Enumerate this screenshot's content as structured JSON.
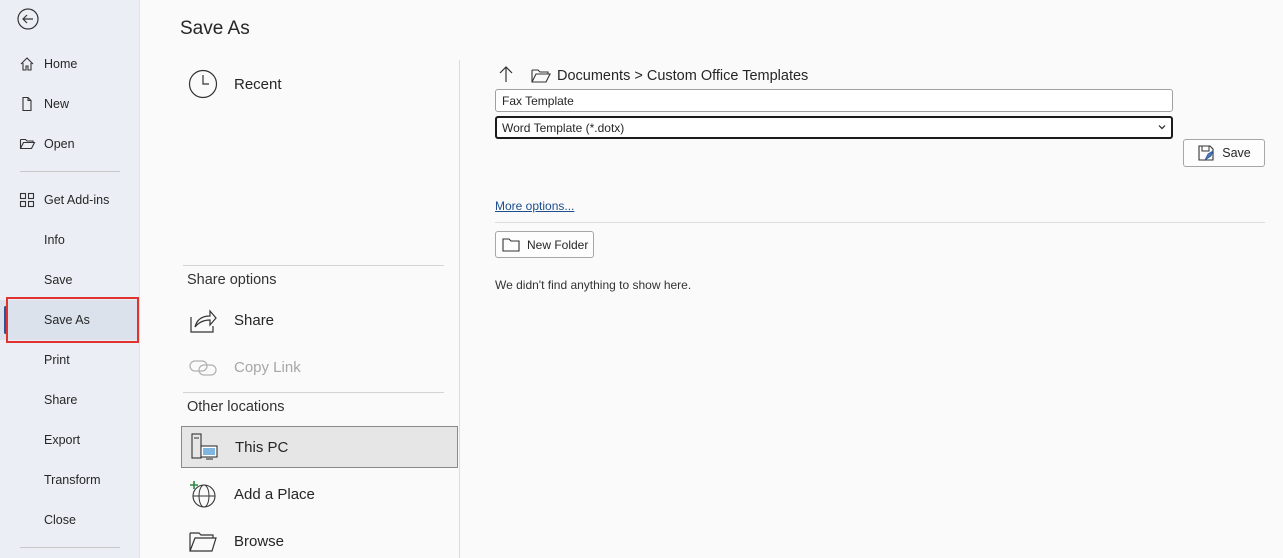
{
  "nav": {
    "items": [
      {
        "label": "Home"
      },
      {
        "label": "New"
      },
      {
        "label": "Open"
      },
      {
        "label": "Get Add-ins"
      },
      {
        "label": "Info"
      },
      {
        "label": "Save"
      },
      {
        "label": "Save As"
      },
      {
        "label": "Print"
      },
      {
        "label": "Share"
      },
      {
        "label": "Export"
      },
      {
        "label": "Transform"
      },
      {
        "label": "Close"
      }
    ],
    "selected": "Save As"
  },
  "main": {
    "title": "Save As",
    "recent_label": "Recent",
    "share_options_header": "Share options",
    "share_label": "Share",
    "copy_link_label": "Copy Link",
    "other_locations_header": "Other locations",
    "this_pc_label": "This PC",
    "add_place_label": "Add a Place",
    "browse_label": "Browse"
  },
  "save_panel": {
    "path": "Documents > Custom Office Templates",
    "filename_value": "Fax Template",
    "filetype_value": "Word Template (*.dotx)",
    "save_button_label": "Save",
    "more_options_label": "More options...",
    "new_folder_label": "New Folder",
    "empty_message": "We didn't find anything to show here."
  },
  "colors": {
    "accent": "#2a5597",
    "highlight": "#e0322e",
    "link": "#1e4e8c"
  }
}
